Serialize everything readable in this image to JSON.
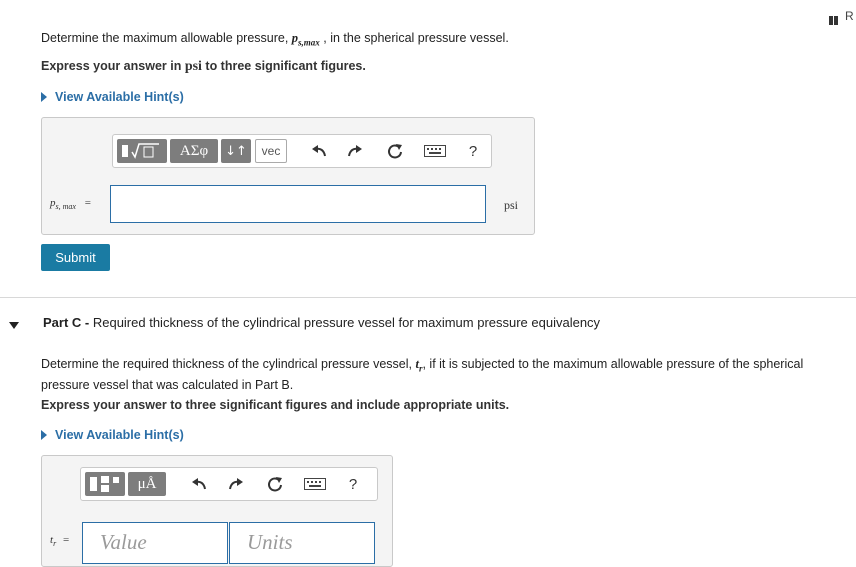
{
  "corner": {
    "label": "R"
  },
  "partB": {
    "question_pre": "Determine the maximum allowable pressure, ",
    "symbol": "p",
    "subscript": "s,max",
    "question_post": " , in the spherical pressure vessel.",
    "instruction_pre": "Express your answer in ",
    "instruction_unit": "psi",
    "instruction_post": " to three significant figures.",
    "hint_label": "View Available Hint(s)",
    "toolbar": {
      "sqrt_label": "√▯",
      "greek_label": "ΑΣφ",
      "arrows_label": "↓↑",
      "vec_label": "vec",
      "help_label": "?"
    },
    "answer_label_sym": "p",
    "answer_label_sub": "s, max",
    "answer_label_eq": "=",
    "answer_value": "",
    "unit": "psi",
    "submit_label": "Submit"
  },
  "partC": {
    "title_bold": "Part C - ",
    "title_rest": "Required thickness of the cylindrical pressure vessel for maximum pressure equivalency",
    "question_pre": "Determine the required thickness of the cylindrical pressure vessel, ",
    "symbol": "t",
    "subscript": "r",
    "question_post": ", if it is subjected to the maximum allowable pressure of the spherical",
    "question_line2": "pressure vessel that was calculated in Part B.",
    "instruction": "Express your answer to three significant figures and include appropriate units.",
    "hint_label": "View Available Hint(s)",
    "toolbar": {
      "mu_label": "μÅ",
      "help_label": "?"
    },
    "answer_label_sym": "t",
    "answer_label_sub": "r",
    "answer_label_eq": "=",
    "value_placeholder": "Value",
    "units_placeholder": "Units"
  }
}
